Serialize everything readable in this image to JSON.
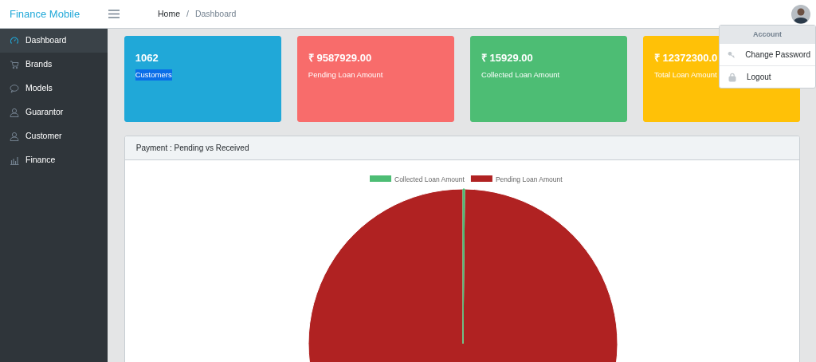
{
  "header": {
    "brand": "Finance Mobile",
    "breadcrumb": [
      {
        "label": "Home",
        "selected": false
      },
      {
        "label": "Dashboard",
        "selected": true
      }
    ],
    "separator": "/"
  },
  "sidebar": {
    "items": [
      {
        "label": "Dashboard",
        "selected": true
      },
      {
        "label": "Brands",
        "selected": false
      },
      {
        "label": "Models",
        "selected": false
      },
      {
        "label": "Guarantor",
        "selected": false
      },
      {
        "label": "Customer",
        "selected": false
      },
      {
        "label": "Finance",
        "selected": false
      }
    ]
  },
  "stats": [
    {
      "value": "1062",
      "label": "Customers",
      "color": "#20a8d8",
      "label_highlighted": true
    },
    {
      "value": "₹ 9587929.00",
      "label": "Pending Loan Amount",
      "color": "#f86c6b",
      "label_highlighted": false
    },
    {
      "value": "₹ 15929.00",
      "label": "Collected Loan Amount",
      "color": "#4dbd74",
      "label_highlighted": false
    },
    {
      "value": "₹ 12372300.0",
      "label": "Total Loan Amount",
      "color": "#ffc107",
      "label_highlighted": false
    }
  ],
  "account_menu": {
    "title": "Account",
    "items": [
      {
        "label": "Change Password"
      },
      {
        "label": "Logout"
      }
    ]
  },
  "chart_card": {
    "title": "Payment : Pending vs Received",
    "chart_data": {
      "type": "pie",
      "categories": [
        "Collected Loan Amount",
        "Pending Loan Amount"
      ],
      "series": [
        {
          "values": [
            0.17,
            99.83
          ]
        }
      ],
      "colors": [
        "#4dbd74",
        "#b02222"
      ],
      "legend": true
    }
  }
}
